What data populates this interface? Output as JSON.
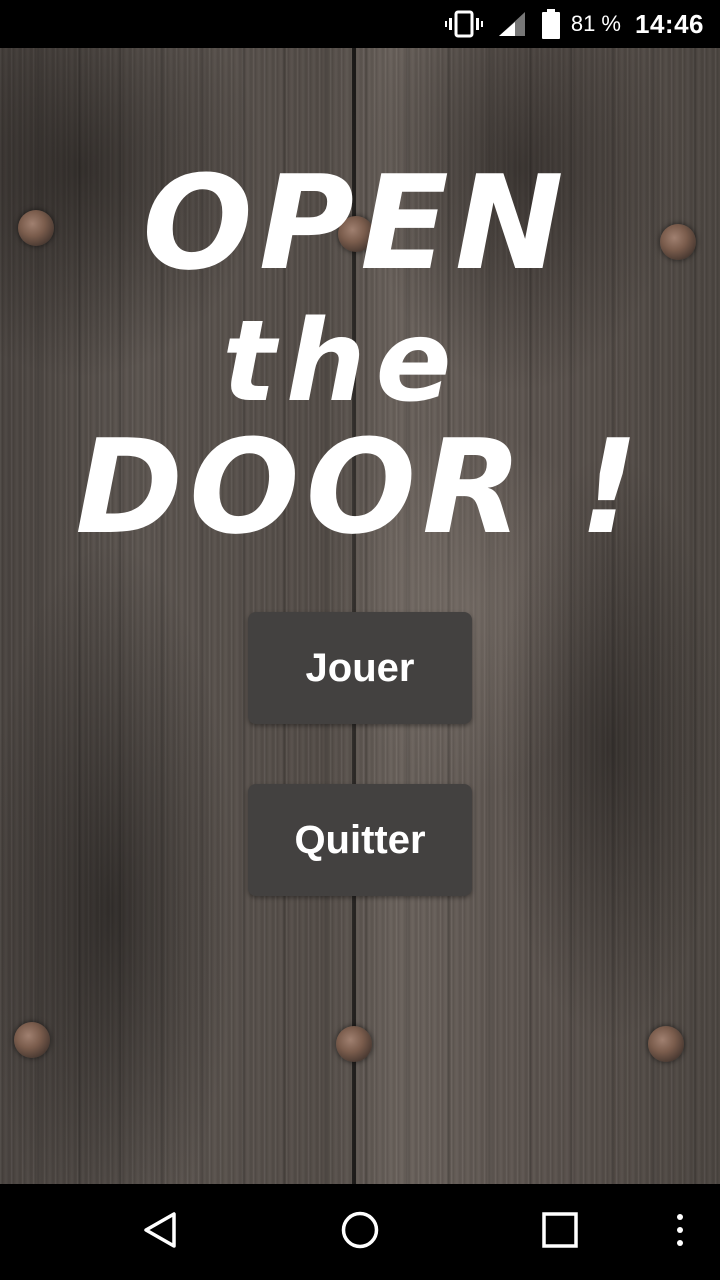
{
  "status_bar": {
    "battery_percent": "81 %",
    "time": "14:46",
    "icons": [
      "vibrate-icon",
      "signal-icon",
      "battery-icon"
    ]
  },
  "game": {
    "title_lines": [
      "OPEN",
      "the",
      "DOOR !"
    ],
    "buttons": {
      "play_label": "Jouer",
      "quit_label": "Quitter"
    },
    "colors": {
      "title": "#ffffff",
      "button_bg": "#434140",
      "button_text": "#ffffff",
      "wood": "#57504b"
    }
  },
  "nav_bar": {
    "icons": [
      "back-icon",
      "home-icon",
      "recents-icon",
      "overflow-menu-icon"
    ]
  }
}
